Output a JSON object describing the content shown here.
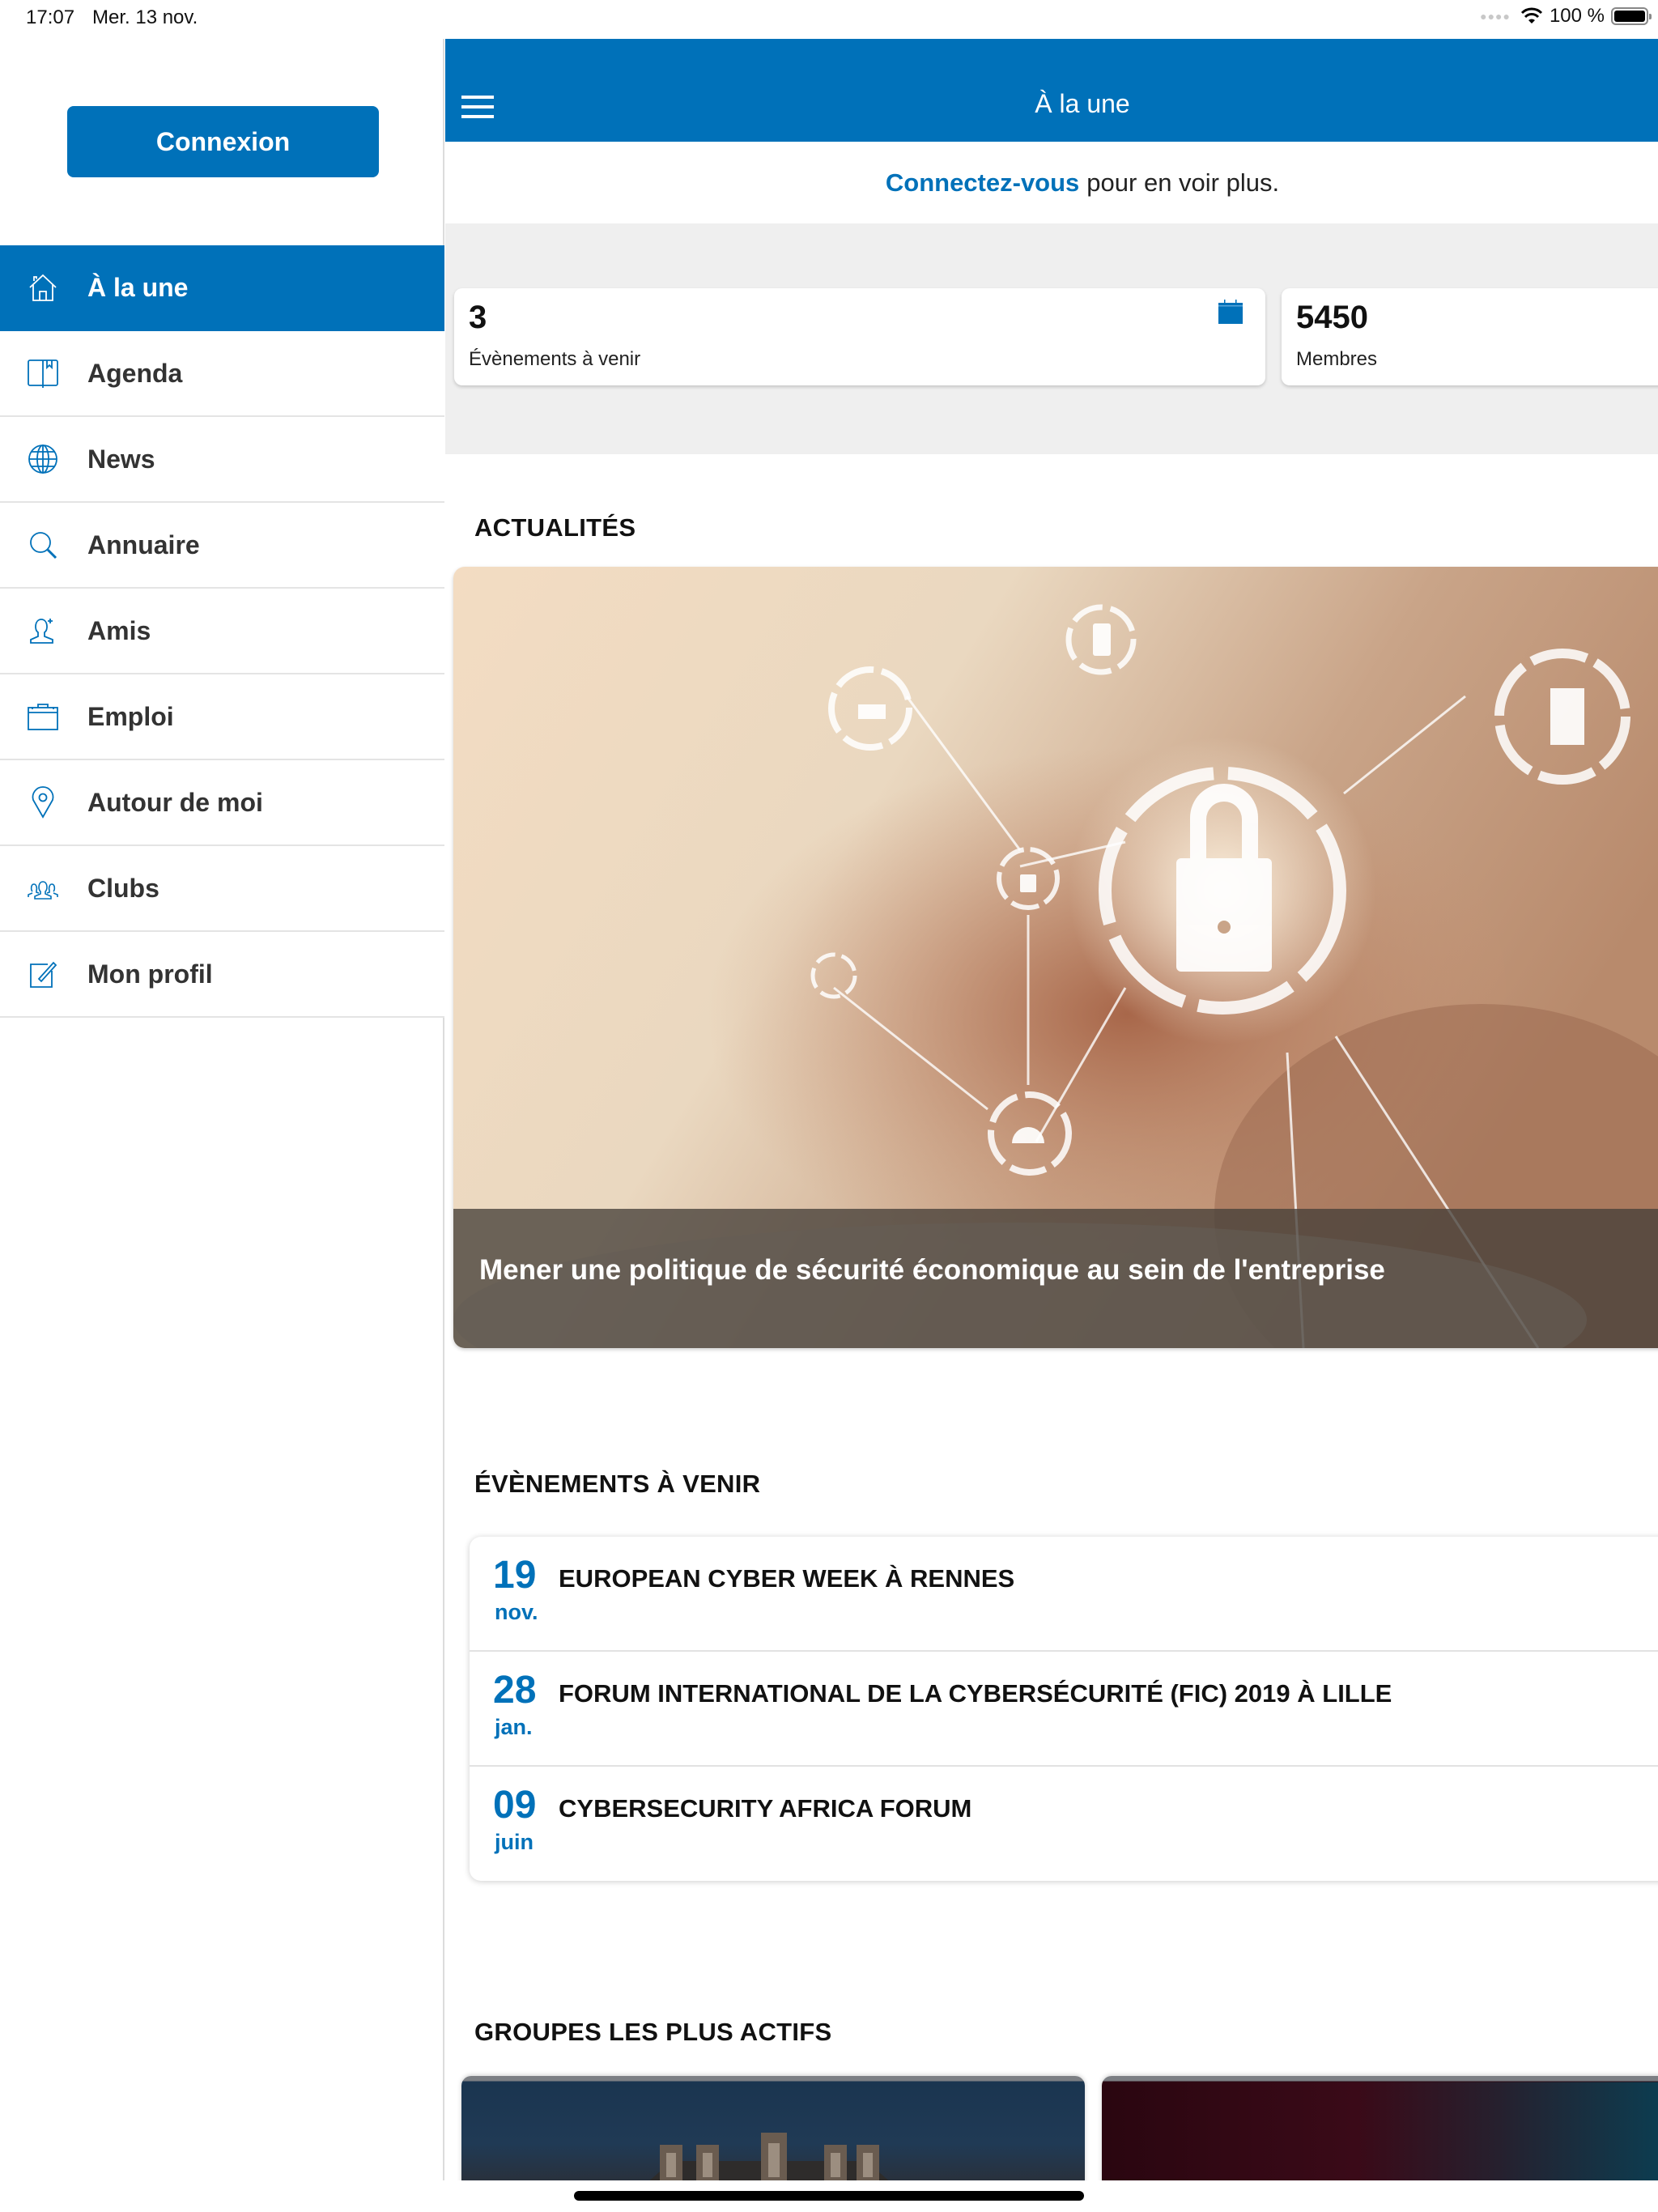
{
  "status_bar": {
    "time": "17:07",
    "date": "Mer. 13 nov.",
    "battery_text": "100 %",
    "battery_level_percent": 100,
    "icons": [
      "signal-dots-icon",
      "wifi-icon",
      "battery-icon"
    ]
  },
  "sidebar": {
    "login_button": "Connexion",
    "active_index": 0,
    "items": [
      {
        "label": "À la une",
        "icon": "home-icon"
      },
      {
        "label": "Agenda",
        "icon": "book-icon"
      },
      {
        "label": "News",
        "icon": "globe-icon"
      },
      {
        "label": "Annuaire",
        "icon": "search-icon"
      },
      {
        "label": "Amis",
        "icon": "add-friend-icon"
      },
      {
        "label": "Emploi",
        "icon": "briefcase-icon"
      },
      {
        "label": "Autour de moi",
        "icon": "map-pin-icon"
      },
      {
        "label": "Clubs",
        "icon": "group-icon"
      },
      {
        "label": "Mon profil",
        "icon": "edit-profile-icon"
      }
    ]
  },
  "header": {
    "title": "À la une",
    "menu_icon": "hamburger-menu-icon"
  },
  "login_hint": {
    "link": "Connectez-vous",
    "text": "pour en voir plus."
  },
  "stats": [
    {
      "value": "3",
      "label": "Évènements à venir",
      "icon": "calendar-icon"
    },
    {
      "value": "5450",
      "label": "Membres"
    }
  ],
  "news": {
    "section_title": "ACTUALITÉS",
    "items": [
      {
        "title": "Mener une politique de sécurité économique au sein de l'entreprise",
        "image": "cybersecurity-lock-photo"
      }
    ]
  },
  "events": {
    "section_title": "ÉVÈNEMENTS À VENIR",
    "items": [
      {
        "day": "19",
        "month": "nov.",
        "title": "EUROPEAN CYBER WEEK À RENNES"
      },
      {
        "day": "28",
        "month": "jan.",
        "title": "FORUM INTERNATIONAL DE LA CYBERSÉCURITÉ (FIC) 2019 À LILLE"
      },
      {
        "day": "09",
        "month": "juin",
        "title": "CYBERSECURITY AFRICA FORUM"
      }
    ]
  },
  "groups": {
    "section_title": "GROUPES LES PLUS ACTIFS",
    "items": [
      {
        "image": "building-rooftop-photo"
      },
      {
        "image": "red-tech-photo"
      }
    ]
  },
  "colors": {
    "accent": "#0071b9",
    "stats_background": "#efefef",
    "text": "#111111"
  }
}
